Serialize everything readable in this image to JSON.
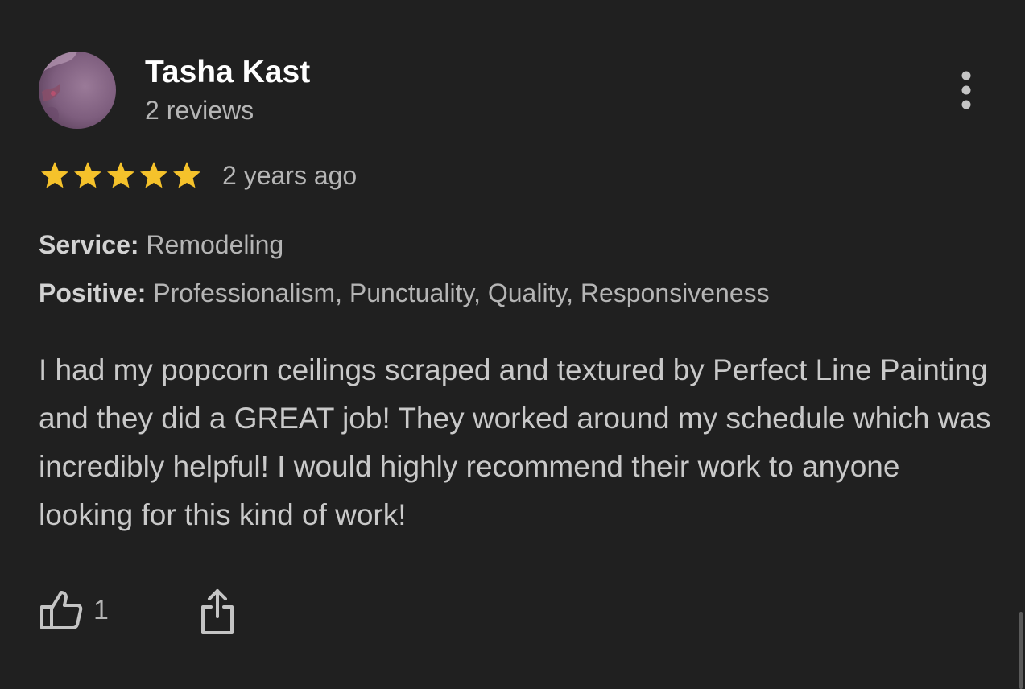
{
  "review": {
    "reviewer_name": "Tasha Kast",
    "review_count": "2 reviews",
    "rating": 5,
    "rating_max": 5,
    "date": "2 years ago",
    "service_label": "Service:",
    "service_value": "Remodeling",
    "positive_label": "Positive:",
    "positive_value": "Professionalism, Punctuality, Quality, Responsiveness",
    "text": "I had my popcorn ceilings scraped and textured by Perfect Line Painting and they did a GREAT job! They worked around my schedule which was incredibly helpful! I would highly recommend their work to anyone looking for this kind of work!",
    "like_count": "1"
  },
  "icons": {
    "more": "more-vertical-icon",
    "star": "star-icon",
    "like": "thumbs-up-icon",
    "share": "share-icon"
  },
  "colors": {
    "background": "#202020",
    "star": "#f5c22b",
    "name": "#ffffff",
    "secondary_text": "#b5b5b5",
    "body_text": "#c9c9c9"
  }
}
